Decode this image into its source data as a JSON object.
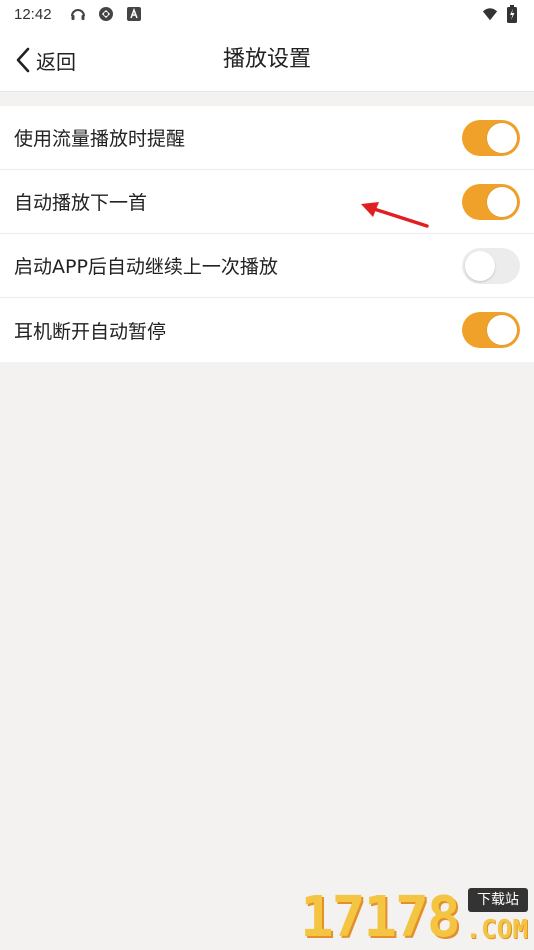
{
  "status_bar": {
    "time": "12:42",
    "left_icons": [
      "headset-icon",
      "sync-icon",
      "app-notification-icon"
    ],
    "right_icons": [
      "wifi-icon",
      "battery-charging-icon"
    ]
  },
  "header": {
    "back_label": "返回",
    "title": "播放设置"
  },
  "settings": [
    {
      "label": "使用流量播放时提醒",
      "enabled": true
    },
    {
      "label": "自动播放下一首",
      "enabled": true
    },
    {
      "label": "启动APP后自动继续上一次播放",
      "enabled": false
    },
    {
      "label": "耳机断开自动暂停",
      "enabled": true
    }
  ],
  "annotation": {
    "type": "arrow",
    "color": "#e02020"
  },
  "watermark": {
    "digits": "17178",
    "badge": "下载站",
    "suffix": ".COM"
  },
  "colors": {
    "accent": "#f0a12a",
    "toggle_off": "#ececec",
    "background": "#f3f2f1"
  }
}
